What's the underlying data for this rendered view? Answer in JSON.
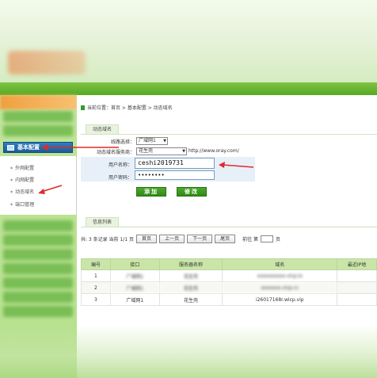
{
  "breadcrumb": "当前位置：首页 > 基本配置 > 动态域名",
  "sidebar": {
    "section": "基本配置",
    "items": [
      "外网配置",
      "内网配置",
      "动态域名",
      "端口管理"
    ]
  },
  "ddns": {
    "tab": "动态域名",
    "line_label": "线路选择：",
    "line_value": "广域网1",
    "provider_label": "动态域名服务商：",
    "provider_value": "花生壳",
    "provider_url": "http://www.oray.com/",
    "username_label": "用户名称：",
    "username_value": "ceshi2019731",
    "password_label": "用户密码：",
    "password_value": "••••••••",
    "add_button": "添加",
    "edit_button": "修改"
  },
  "info": {
    "tab": "信息列表",
    "pager_summary": "共: 3 条记录  当前 1/1 页",
    "first": "首页",
    "prev": "上一页",
    "next": "下一页",
    "last": "尾页",
    "goto_prefix": "前往 第",
    "goto_suffix": "页",
    "columns": [
      "编号",
      "接口",
      "服务器名称",
      "域名",
      "最近IP地"
    ],
    "rows": [
      {
        "id": "1",
        "iface": "广域网1",
        "server": "花生壳",
        "domain": "xxxxxxxxxx.vicp.io",
        "ip": ""
      },
      {
        "id": "2",
        "iface": "广域网1",
        "server": "花生壳",
        "domain": "xxxxxxx.vicp.cc",
        "ip": ""
      },
      {
        "id": "3",
        "iface": "广域网1",
        "server": "花生壳",
        "domain": "i26017168r.wicp.vip",
        "ip": ""
      }
    ]
  },
  "colors": {
    "brand_green": "#58a923",
    "sidebar_green": "#b6e08d",
    "annotation_red": "#e02a2a",
    "nav_active_blue": "#1c5a98"
  }
}
